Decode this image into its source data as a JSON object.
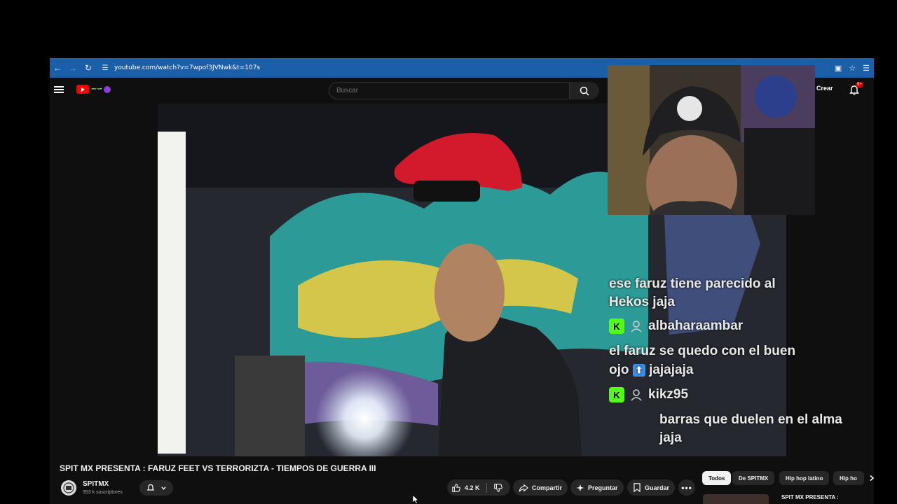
{
  "browser": {
    "url": "youtube.com/watch?v=7wpof3JVNwk&t=107s"
  },
  "header": {
    "search_placeholder": "Buscar",
    "create_label": "Crear",
    "notifications_badge": "9+"
  },
  "chat": {
    "messages": [
      {
        "line1": "ese faruz tiene parecido al",
        "line2": "Hekos jaja"
      },
      {
        "user": "albaharaambar",
        "line1": "el faruz se quedo con el buen",
        "line2_a": "ojo",
        "line2_b": "jajajaja"
      },
      {
        "user": "kikz95",
        "line1": "barras que duelen en el alma",
        "line2": "jaja"
      }
    ]
  },
  "video": {
    "title": "SPIT MX PRESENTA : FARUZ FEET VS TERRORIZTA - TIEMPOS DE GUERRA III",
    "channel": "SPITMX",
    "subscribers": "353 k suscriptores",
    "likes": "4.2 K",
    "share_label": "Compartir",
    "ask_label": "Preguntar",
    "save_label": "Guardar"
  },
  "chips": [
    "Todos",
    "De SPITMX",
    "Hip hop latino",
    "Hip ho"
  ],
  "recommendation": {
    "title": "SPIT MX PRESENTA :"
  },
  "colors": {
    "kick_green": "#53fc18",
    "url_bar": "#1b5fa8",
    "yt_red": "#ff0000"
  }
}
